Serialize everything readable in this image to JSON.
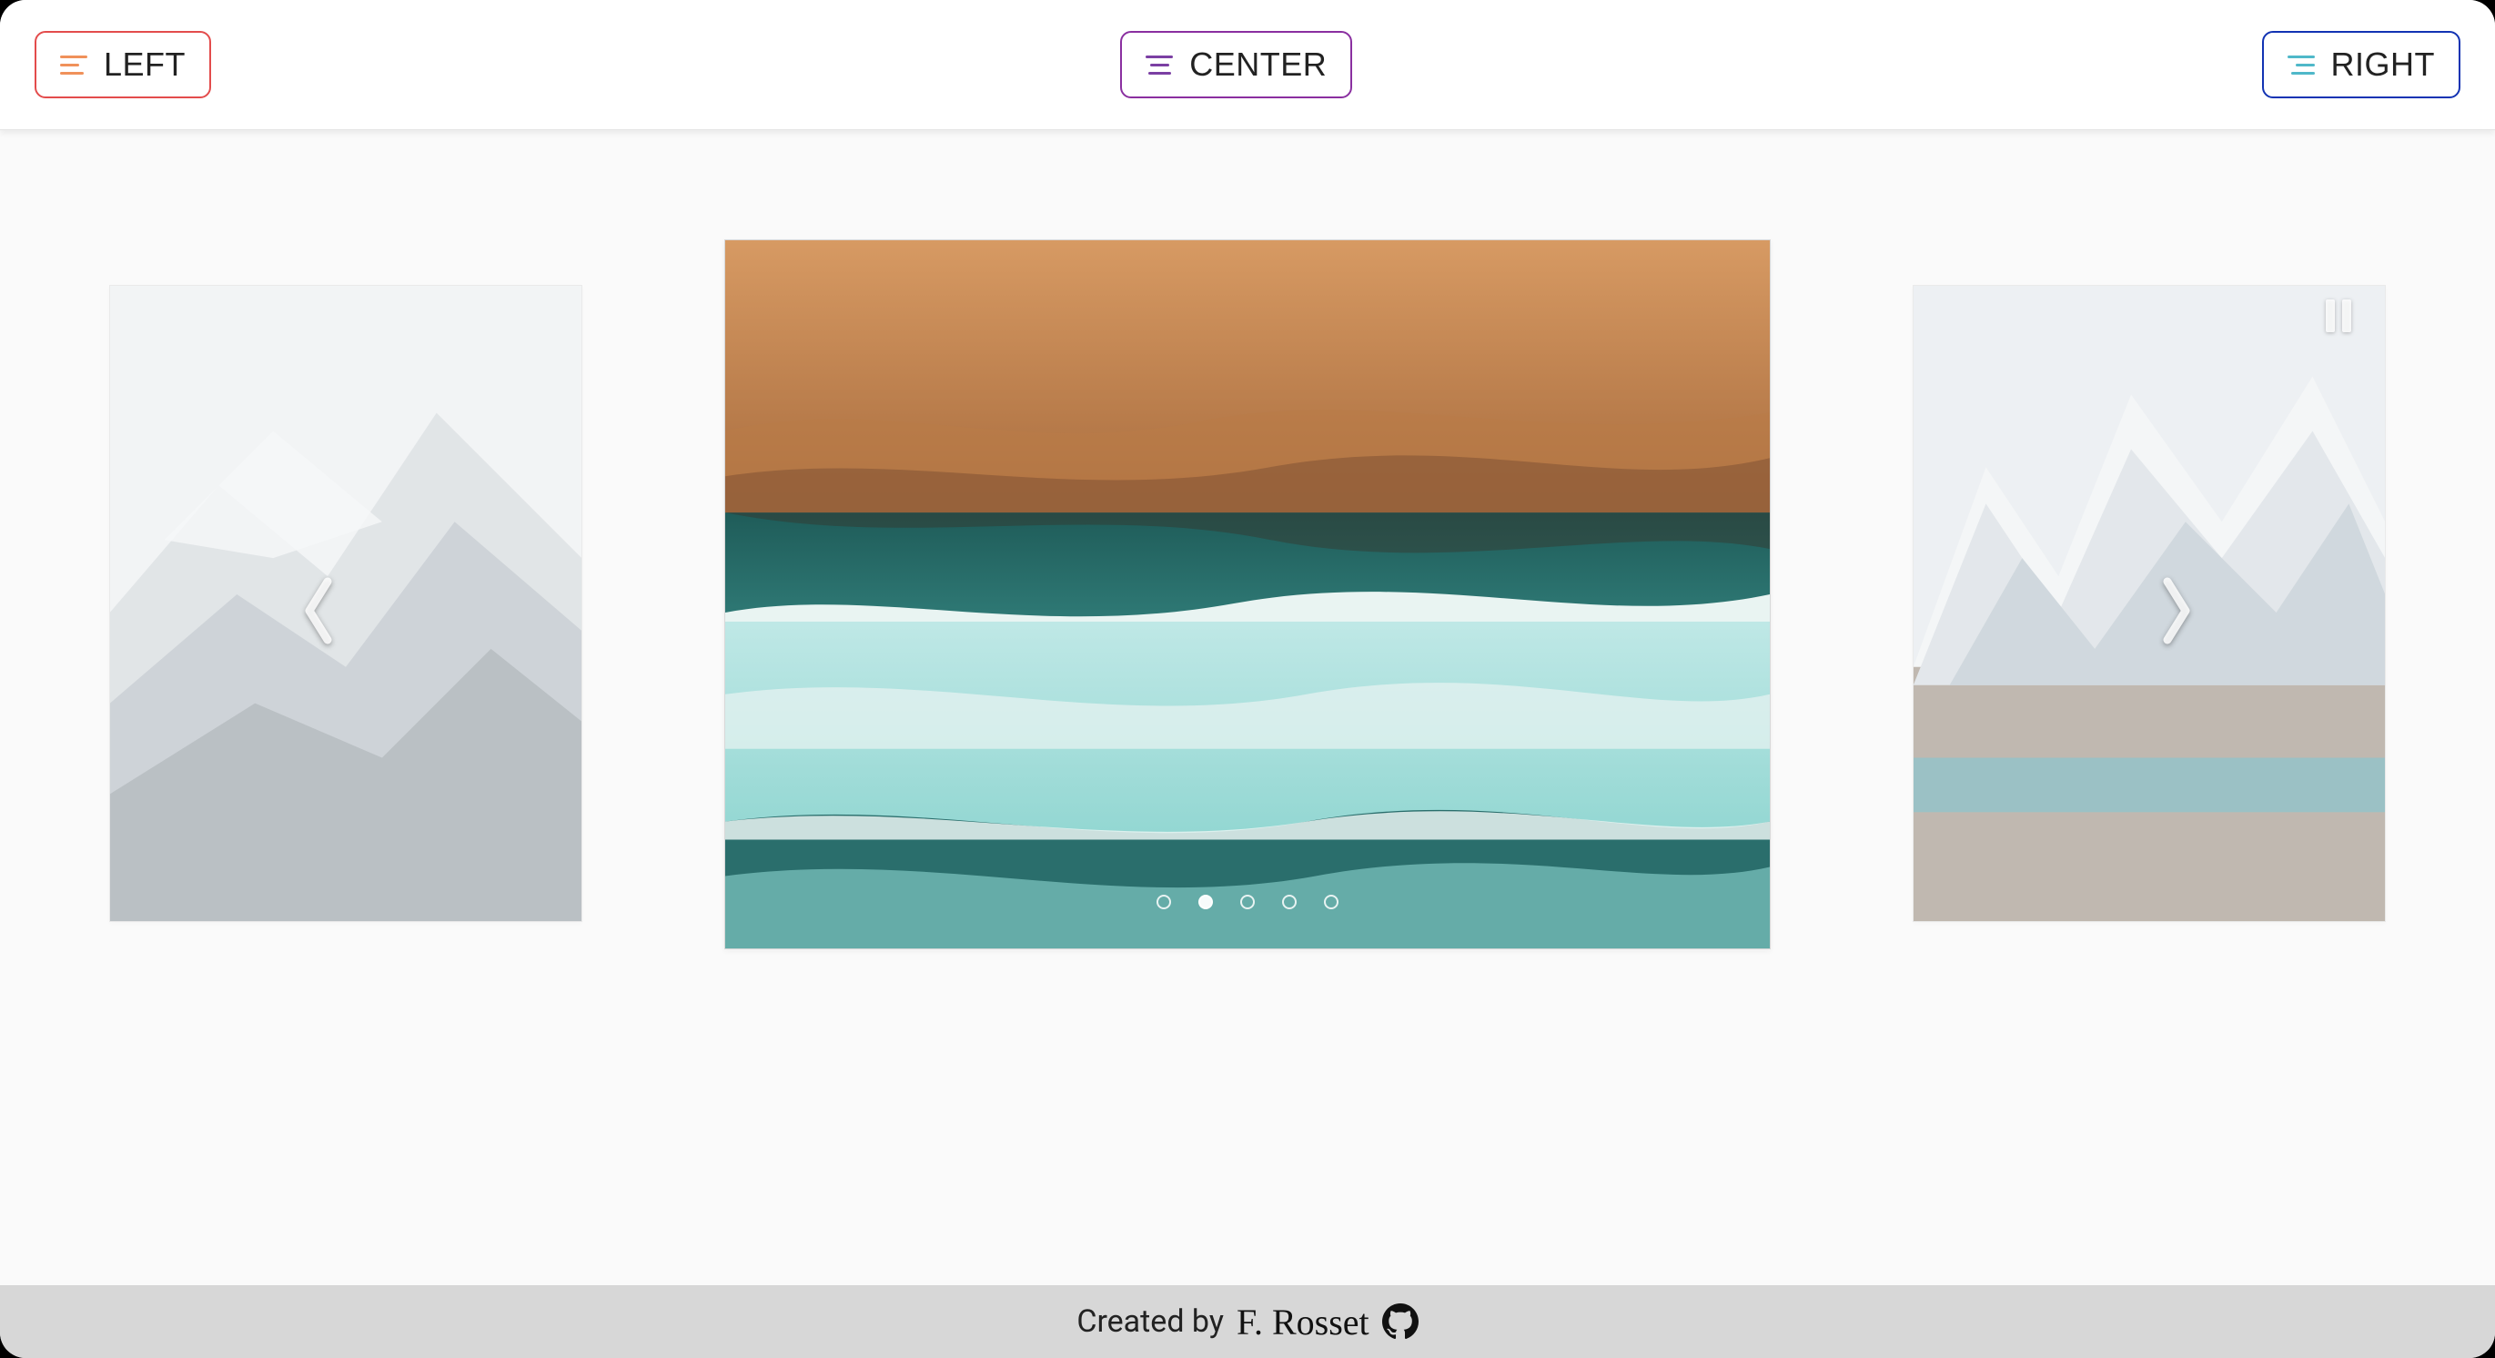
{
  "header": {
    "left_label": "LEFT",
    "center_label": "CENTER",
    "right_label": "RIGHT",
    "colors": {
      "left_border": "#e34c4c",
      "center_border": "#8a2fa0",
      "right_border": "#1233b3",
      "left_icon": "#f0915a",
      "center_icon": "#7b3fa3",
      "right_icon": "#4fb8c9"
    }
  },
  "carousel": {
    "active_index": 1,
    "total_slides": 5,
    "playing": true,
    "prev_slide": {
      "name": "mountain-grey",
      "palette": [
        "#e9edf0",
        "#c5ccd2",
        "#7e8a94",
        "#3c454d"
      ]
    },
    "current_slide": {
      "name": "beach-aerial",
      "palette": [
        "#c98a54",
        "#8c5a37",
        "#2a6e6c",
        "#86d1d0",
        "#e8f3f2"
      ]
    },
    "next_slide": {
      "name": "patagonia-peaks",
      "palette": [
        "#e9eef2",
        "#cfd7dd",
        "#8aa6b8",
        "#5a4b3f",
        "#2a7e86"
      ]
    },
    "controls": {
      "prev_icon": "chevron-left",
      "next_icon": "chevron-right",
      "pause_icon": "pause"
    }
  },
  "footer": {
    "text": "Created by",
    "author": "F. Rosset",
    "github_icon": "github-icon"
  }
}
